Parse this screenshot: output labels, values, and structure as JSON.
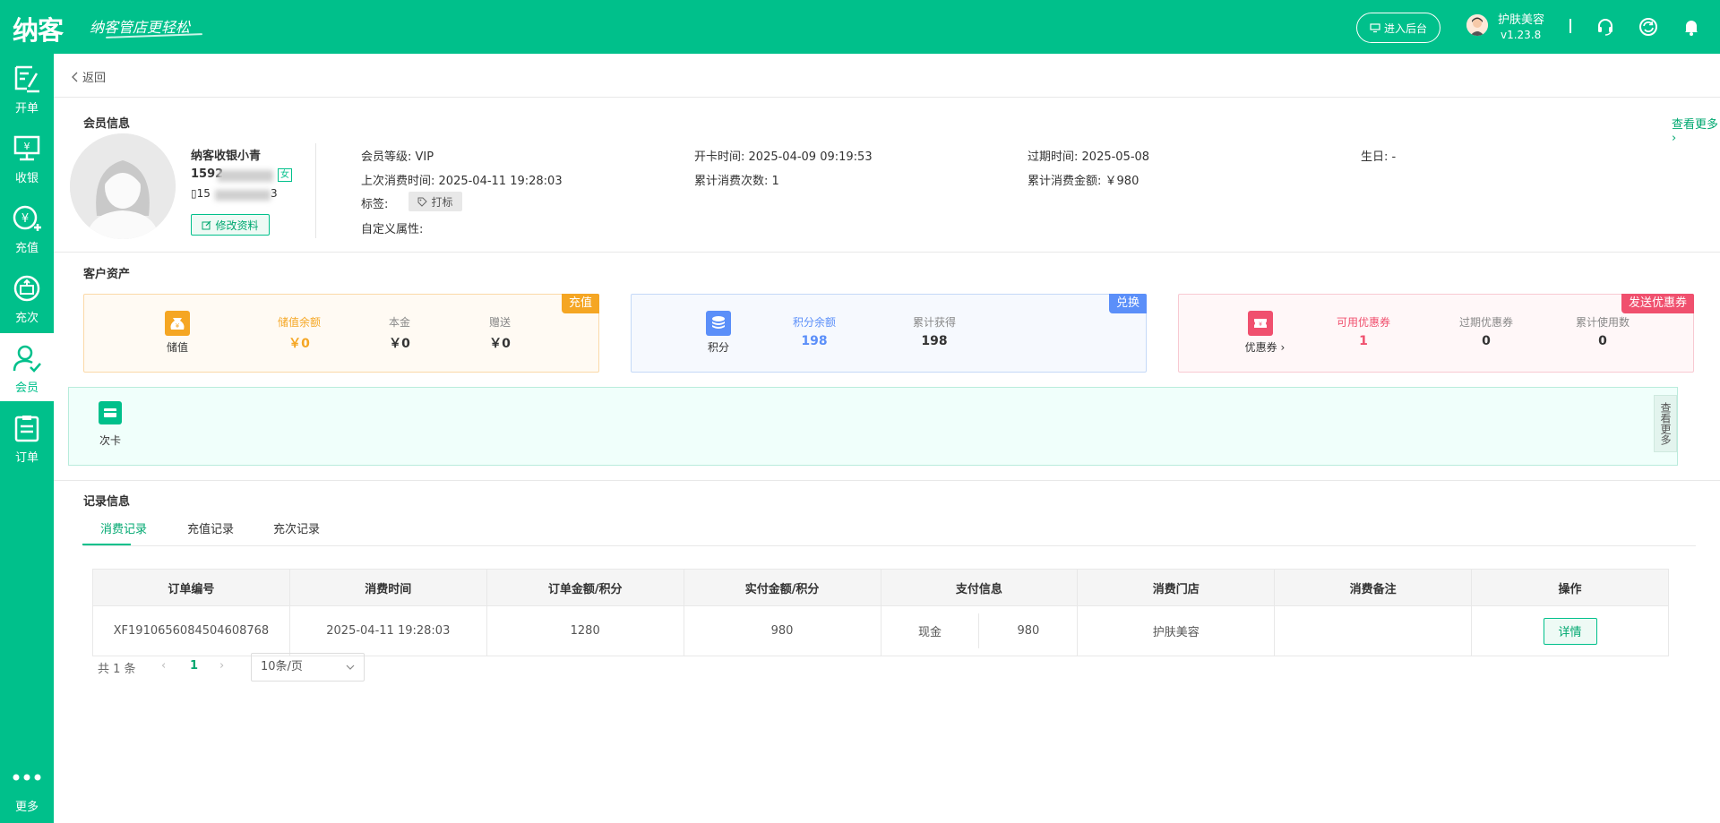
{
  "header": {
    "logo": "纳客",
    "slogan": "纳客管店更轻松",
    "backend_button": "进入后台",
    "user_name": "护肤美容",
    "version": "v1.23.8"
  },
  "sidebar": {
    "items": [
      {
        "label": "开单"
      },
      {
        "label": "收银"
      },
      {
        "label": "充值"
      },
      {
        "label": "充次"
      },
      {
        "label": "会员"
      },
      {
        "label": "订单"
      }
    ],
    "more_label": "更多"
  },
  "back_label": "返回",
  "member": {
    "section_title": "会员信息",
    "see_more": "查看更多",
    "name": "纳客收银小青",
    "phone_visible": "1592",
    "gender": "女",
    "phone2_prefix": "15",
    "phone2_suffix": "3",
    "edit_button": "修改资料",
    "level_label": "会员等级:",
    "level_value": "VIP",
    "open_time_label": "开卡时间:",
    "open_time_value": "2025-04-09 09:19:53",
    "expire_label": "过期时间:",
    "expire_value": "2025-05-08",
    "birthday_label": "生日:",
    "birthday_value": "-",
    "last_consume_label": "上次消费时间:",
    "last_consume_value": "2025-04-11 19:28:03",
    "consume_count_label": "累计消费次数:",
    "consume_count_value": "1",
    "consume_amount_label": "累计消费金额:",
    "consume_amount_value": "￥980",
    "tag_label": "标签:",
    "tag_button": "打标",
    "custom_attr_label": "自定义属性:"
  },
  "assets": {
    "section_title": "客户资产",
    "stored": {
      "badge": "充值",
      "icon_label": "储值",
      "cols": [
        {
          "label": "储值余额",
          "value": "￥0"
        },
        {
          "label": "本金",
          "value": "￥0"
        },
        {
          "label": "赠送",
          "value": "￥0"
        }
      ]
    },
    "points": {
      "badge": "兑换",
      "icon_label": "积分",
      "cols": [
        {
          "label": "积分余额",
          "value": "198"
        },
        {
          "label": "累计获得",
          "value": "198"
        }
      ]
    },
    "coupons": {
      "badge": "发送优惠券",
      "icon_label": "优惠券",
      "cols": [
        {
          "label": "可用优惠券",
          "value": "1"
        },
        {
          "label": "过期优惠券",
          "value": "0"
        },
        {
          "label": "累计使用数",
          "value": "0"
        }
      ]
    },
    "times_card": {
      "icon_label": "次卡",
      "side_button": "查看更多"
    }
  },
  "records": {
    "section_title": "记录信息",
    "tabs": [
      "消费记录",
      "充值记录",
      "充次记录"
    ],
    "columns": [
      "订单编号",
      "消费时间",
      "订单金额/积分",
      "实付金额/积分",
      "支付信息",
      "消费门店",
      "消费备注",
      "操作"
    ],
    "rows": [
      {
        "order_no": "XF1910656084504608768",
        "time": "2025-04-11 19:28:03",
        "order_amount": "1280",
        "paid_amount": "980",
        "pay_method": "现金",
        "pay_amount": "980",
        "store": "护肤美容",
        "note": "",
        "action": "详情"
      }
    ],
    "total_text": "共 1 条",
    "current_page": "1",
    "page_size": "10条/页"
  },
  "colors": {
    "brand": "#00c08b",
    "orange": "#f5a623",
    "blue": "#5b8ff9",
    "pink": "#f0506e"
  }
}
